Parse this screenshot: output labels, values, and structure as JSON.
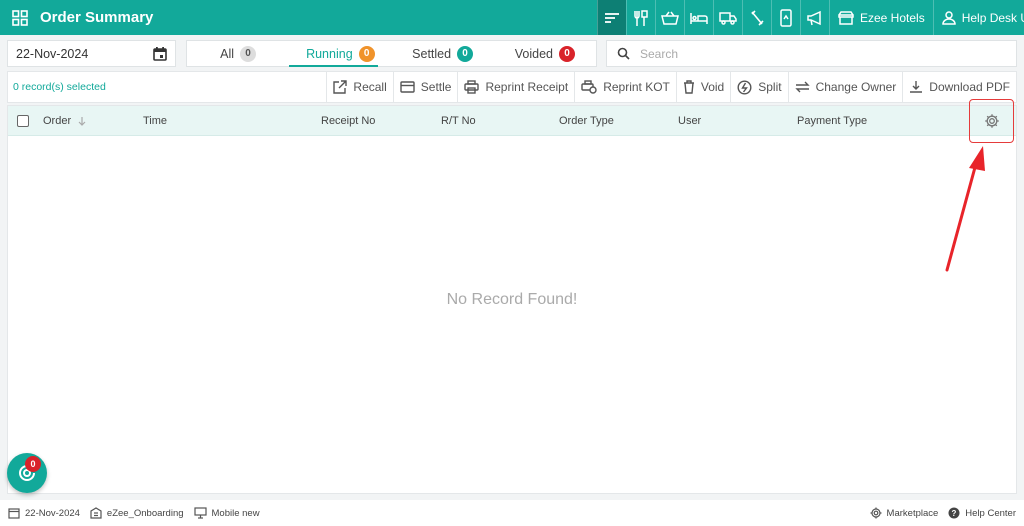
{
  "header": {
    "title": "Order Summary",
    "hotel": "Ezee Hotels",
    "user": "Help Desk U...",
    "nav_icons": [
      "order-list-icon",
      "restaurant-icon",
      "basket-icon",
      "bed-icon",
      "delivery-truck-icon",
      "slash-tool-icon",
      "phone-icon",
      "megaphone-icon"
    ]
  },
  "filters": {
    "date": "22-Nov-2024",
    "tabs": [
      {
        "label": "All",
        "count": "0"
      },
      {
        "label": "Running",
        "count": "0"
      },
      {
        "label": "Settled",
        "count": "0"
      },
      {
        "label": "Voided",
        "count": "0"
      }
    ],
    "active_tab": "Running",
    "search_placeholder": "Search"
  },
  "actionbar": {
    "selected": "0 record(s) selected",
    "actions": [
      "Recall",
      "Settle",
      "Reprint Receipt",
      "Reprint KOT",
      "Void",
      "Split",
      "Change Owner",
      "Download PDF"
    ]
  },
  "table": {
    "columns": [
      "Order",
      "Time",
      "Receipt No",
      "R/T No",
      "Order Type",
      "User",
      "Payment Type"
    ],
    "empty_message": "No Record Found!"
  },
  "fab": {
    "badge": "0"
  },
  "footer": {
    "date": "22-Nov-2024",
    "property": "eZee_Onboarding",
    "device": "Mobile new",
    "marketplace": "Marketplace",
    "help": "Help Center"
  },
  "colors": {
    "accent": "#12a99a",
    "accent_dark": "#0d7f74",
    "annotation": "#e53b3b"
  }
}
